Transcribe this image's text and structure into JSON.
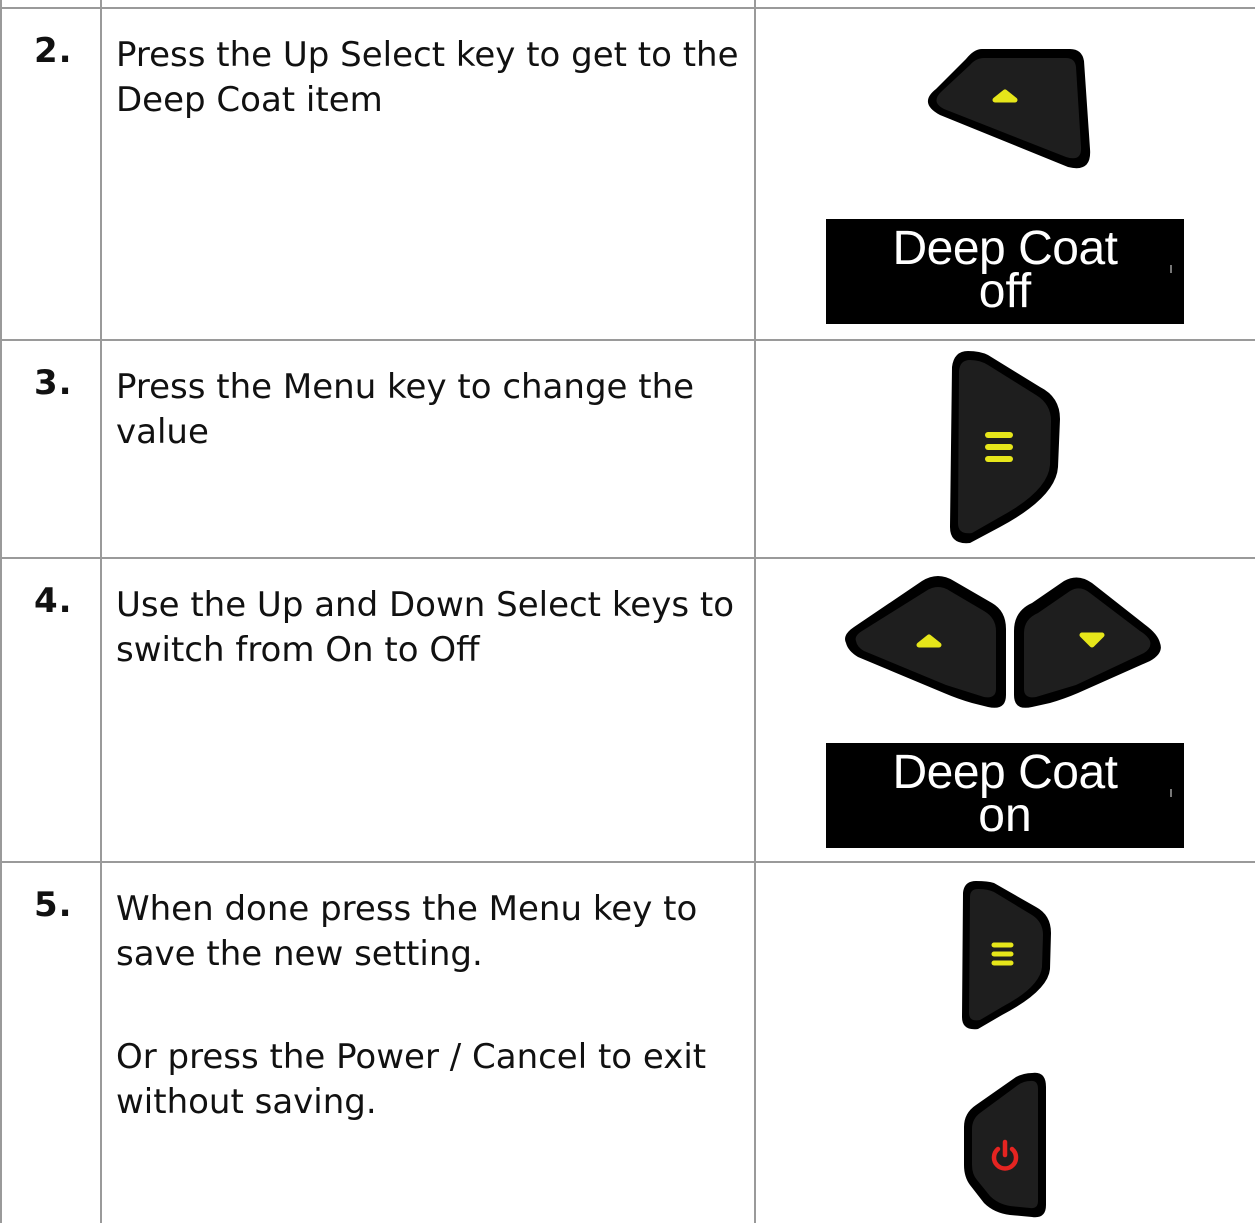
{
  "steps": [
    {
      "number": "2.",
      "text": "Press the Up Select key to get to the Deep Coat item",
      "keys": [
        "up-select-key"
      ],
      "display": {
        "line1": "Deep Coat",
        "line2": "off"
      }
    },
    {
      "number": "3.",
      "text": "Press the Menu key to change the value",
      "keys": [
        "menu-key"
      ]
    },
    {
      "number": "4.",
      "text": "Use the Up and Down Select keys to switch from On to Off",
      "keys": [
        "up-select-key",
        "down-select-key"
      ],
      "display": {
        "line1": "Deep Coat",
        "line2": "on"
      }
    },
    {
      "number": "5.",
      "text": "When done press the Menu key to save the new setting.",
      "text2": "Or press the Power / Cancel to exit without saving.",
      "keys": [
        "menu-key",
        "power-cancel-key"
      ]
    }
  ],
  "colors": {
    "key_body": "#1e1e1e",
    "key_rim": "#000000",
    "key_symbol_yellow": "#e6e61a",
    "key_symbol_red": "#e52421",
    "display_bg": "#000000",
    "display_text": "#ffffff",
    "grid": "#9a9a9a"
  }
}
